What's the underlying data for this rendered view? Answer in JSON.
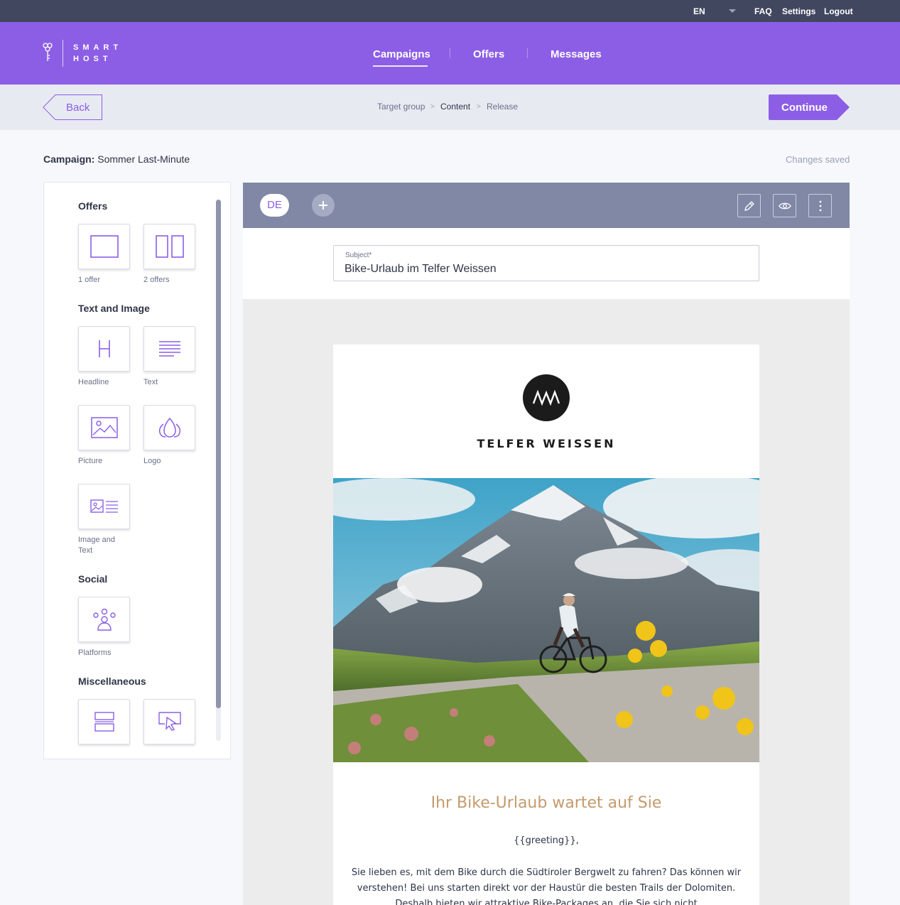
{
  "utility": {
    "language": "EN",
    "faq": "FAQ",
    "settings": "Settings",
    "logout": "Logout"
  },
  "brand": {
    "line1": "SMART",
    "line2": "HOST",
    "primary_color": "#8c5ee6"
  },
  "nav": {
    "campaigns": "Campaigns",
    "offers": "Offers",
    "messages": "Messages",
    "active": "Campaigns"
  },
  "steps": {
    "back": "Back",
    "target_group": "Target group",
    "content": "Content",
    "release": "Release",
    "separator": ">",
    "continue": "Continue",
    "active": "Content"
  },
  "campaign": {
    "label": "Campaign:",
    "name": "Sommer Last-Minute",
    "status": "Changes saved"
  },
  "sidebar": {
    "offers_title": "Offers",
    "one_offer": "1 offer",
    "two_offers": "2 offers",
    "text_image_title": "Text and Image",
    "headline": "Headline",
    "text": "Text",
    "picture": "Picture",
    "logo": "Logo",
    "image_and_text_1": "Image and",
    "image_and_text_2": "Text",
    "social_title": "Social",
    "platforms": "Platforms",
    "misc_title": "Miscellaneous"
  },
  "editor": {
    "language_tab": "DE",
    "subject_label": "Subject*",
    "subject_value": "Bike-Urlaub im Telfer Weissen"
  },
  "email": {
    "brand_name": "TELFER WEISSEN",
    "headline": "Ihr Bike-Urlaub wartet auf Sie",
    "greeting": "{{greeting}},",
    "body": "Sie lieben es, mit dem Bike durch die Südtiroler Bergwelt zu fahren? Das können wir verstehen! Bei uns starten direkt vor der Haustür die besten Trails der Dolomiten. Deshalb bieten wir attraktive Bike-Packages an, die Sie sich nicht",
    "headline_color": "#c49a6c"
  }
}
